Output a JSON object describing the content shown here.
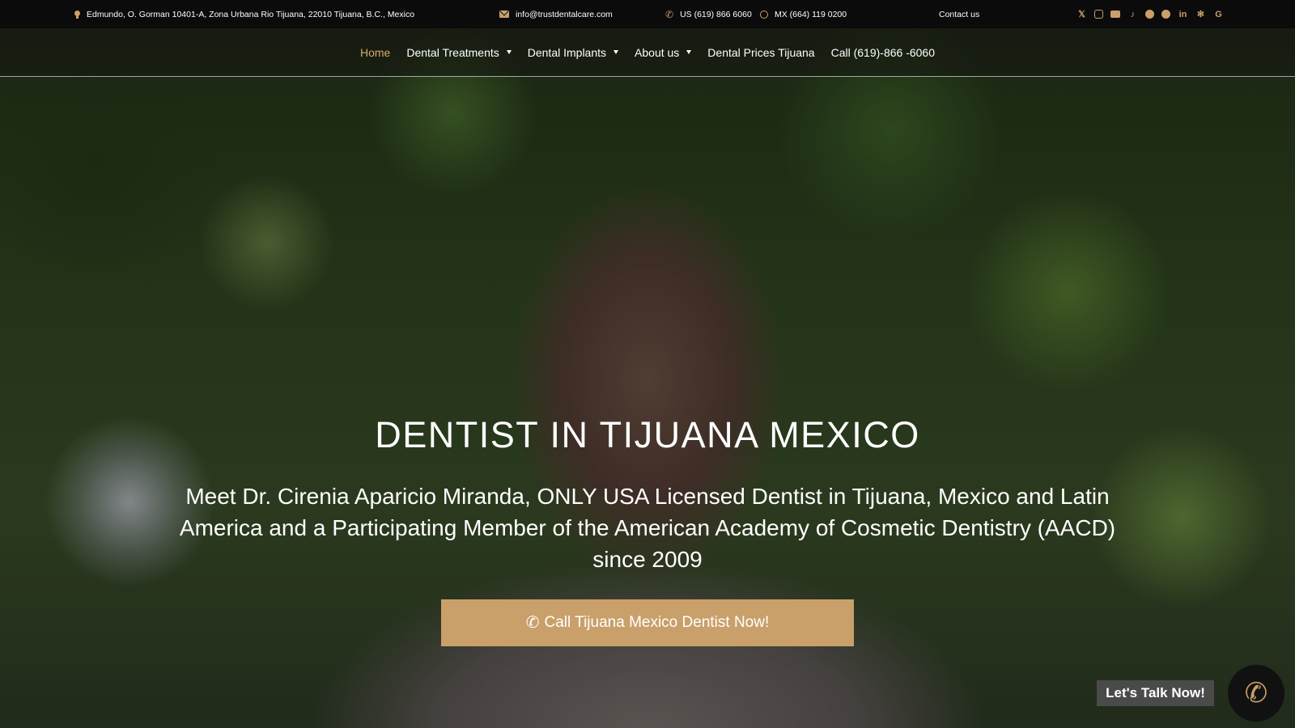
{
  "topbar": {
    "address": "Edmundo, O. Gorman 10401-A, Zona Urbana Rio Tijuana, 22010 Tijuana, B.C., Mexico",
    "email": "info@trustdentalcare.com",
    "phone_us": "US (619) 866 6060",
    "phone_mx": "MX (664) 119 0200",
    "contact_label": "Contact us",
    "socials": [
      "x-icon",
      "instagram-icon",
      "youtube-icon",
      "tiktok-icon",
      "facebook-icon",
      "pinterest-icon",
      "linkedin-icon",
      "yelp-icon",
      "google-icon"
    ]
  },
  "nav": {
    "home": "Home",
    "treatments": "Dental Treatments",
    "implants": "Dental Implants",
    "about": "About us",
    "prices": "Dental Prices Tijuana",
    "call": "Call (619)-866 -6060"
  },
  "hero": {
    "title": "DENTIST IN TIJUANA MEXICO",
    "subtitle": "Meet Dr. Cirenia Aparicio Miranda, ONLY USA Licensed Dentist in Tijuana, Mexico and Latin America and a Participating Member of the American Academy of Cosmetic Dentistry (AACD) since 2009",
    "cta_label": "Call Tijuana Mexico Dentist Now!"
  },
  "chat": {
    "label": "Let's Talk Now!"
  },
  "colors": {
    "accent": "#c9a06a",
    "nav_active": "#d6a96a",
    "topbar_bg": "#0b0b0b"
  }
}
